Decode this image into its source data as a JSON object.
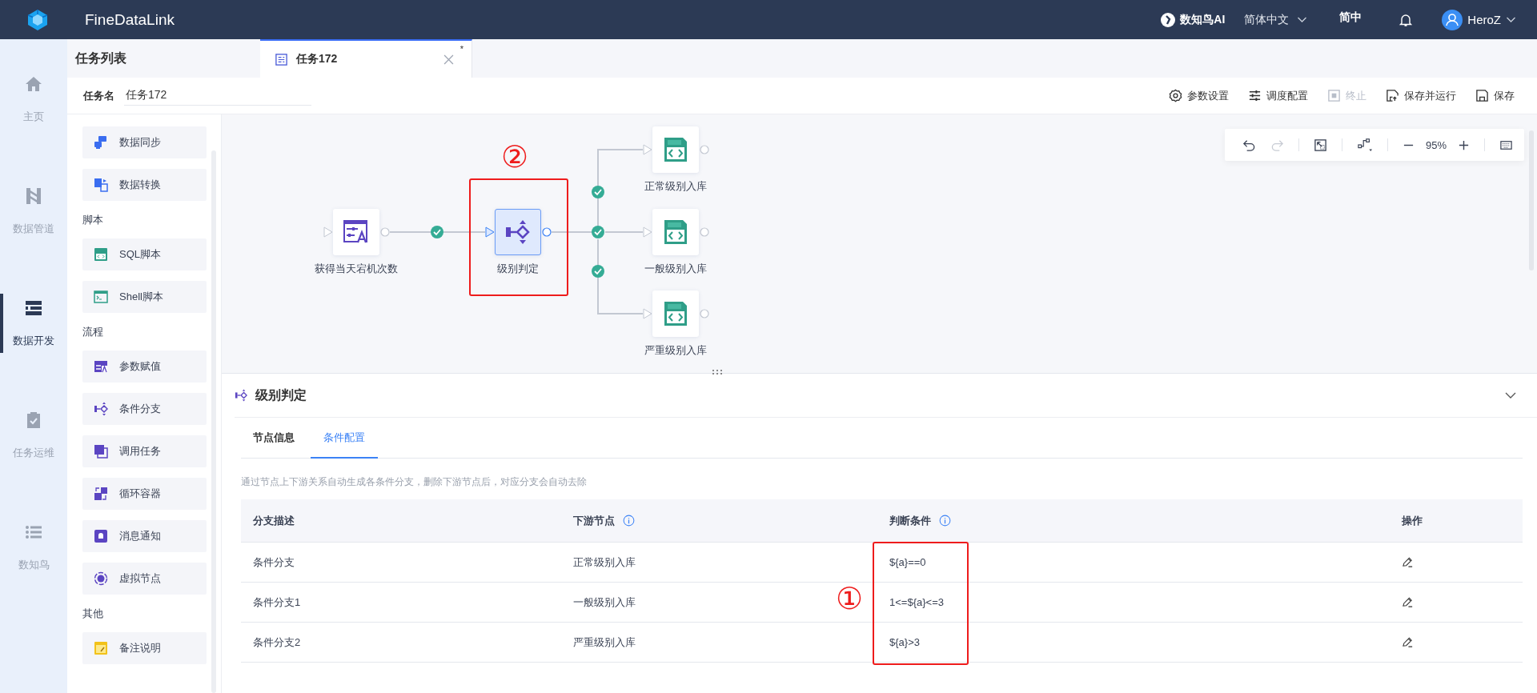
{
  "topbar": {
    "app_name": "FineDataLink",
    "ai_label": "数知鸟AI",
    "language": "简体中文",
    "lang_short": "简中",
    "user": "HeroZ"
  },
  "nav": [
    {
      "kind": "home",
      "label": "主页",
      "selected": false
    },
    {
      "kind": "pipeline",
      "label": "数据管道",
      "selected": false
    },
    {
      "kind": "develop",
      "label": "数据开发",
      "selected": true
    },
    {
      "kind": "ops",
      "label": "任务运维",
      "selected": false
    },
    {
      "kind": "ai",
      "label": "数知鸟",
      "selected": false
    }
  ],
  "panel_title": "任务列表",
  "tabs": [
    {
      "label": "任务172",
      "selected": true,
      "modified_mark": "*"
    }
  ],
  "task_name": {
    "label": "任务名",
    "value": "任务172"
  },
  "actions": [
    {
      "kind": "params",
      "label": "参数设置",
      "disabled": false
    },
    {
      "kind": "schedule",
      "label": "调度配置",
      "disabled": false
    },
    {
      "kind": "stop",
      "label": "终止",
      "disabled": true
    },
    {
      "kind": "save-run",
      "label": "保存并运行",
      "disabled": false
    },
    {
      "kind": "save",
      "label": "保存",
      "disabled": false
    }
  ],
  "palette": [
    {
      "items": [
        {
          "kind": "sync",
          "label": "数据同步"
        },
        {
          "kind": "transform",
          "label": "数据转换"
        }
      ]
    },
    {
      "title": "脚本",
      "items": [
        {
          "kind": "sql",
          "label": "SQL脚本"
        },
        {
          "kind": "shell",
          "label": "Shell脚本"
        }
      ]
    },
    {
      "title": "流程",
      "items": [
        {
          "kind": "assign",
          "label": "参数赋值"
        },
        {
          "kind": "branch",
          "label": "条件分支"
        },
        {
          "kind": "call",
          "label": "调用任务"
        },
        {
          "kind": "loop",
          "label": "循环容器"
        },
        {
          "kind": "notify",
          "label": "消息通知"
        },
        {
          "kind": "virtual",
          "label": "虚拟节点"
        }
      ]
    },
    {
      "title": "其他",
      "items": [
        {
          "kind": "note",
          "label": "备注说明"
        }
      ]
    }
  ],
  "canvas": {
    "nodes": [
      {
        "kind": "assign",
        "label": "获得当天宕机次数",
        "selected": false
      },
      {
        "kind": "branch",
        "label": "级别判定",
        "selected": true
      },
      {
        "kind": "sql",
        "label": "正常级别入库",
        "selected": false
      },
      {
        "kind": "sql",
        "label": "一般级别入库",
        "selected": false
      },
      {
        "kind": "sql",
        "label": "严重级别入库",
        "selected": false
      }
    ],
    "toolbar": {
      "redo_disabled": true,
      "zoom": "95%"
    }
  },
  "detail": {
    "title": "级别判定",
    "tabs": [
      {
        "label": "节点信息",
        "selected": false
      },
      {
        "label": "条件配置",
        "selected": true
      }
    ],
    "hint": "通过节点上下游关系自动生成各条件分支，删除下游节点后，对应分支会自动去除",
    "columns": [
      {
        "label": "分支描述",
        "info": false
      },
      {
        "label": "下游节点",
        "info": true
      },
      {
        "label": "判断条件",
        "info": true
      },
      {
        "label": "操作",
        "info": false
      }
    ],
    "rows": [
      {
        "description": "条件分支",
        "downstream": "正常级别入库",
        "condition": "${a}==0"
      },
      {
        "description": "条件分支1",
        "downstream": "一般级别入库",
        "condition": "1<=${a}<=3"
      },
      {
        "description": "条件分支2",
        "downstream": "严重级别入库",
        "condition": "${a}>3"
      }
    ]
  },
  "annotations": [
    {
      "label": "②"
    },
    {
      "label": "①"
    }
  ]
}
